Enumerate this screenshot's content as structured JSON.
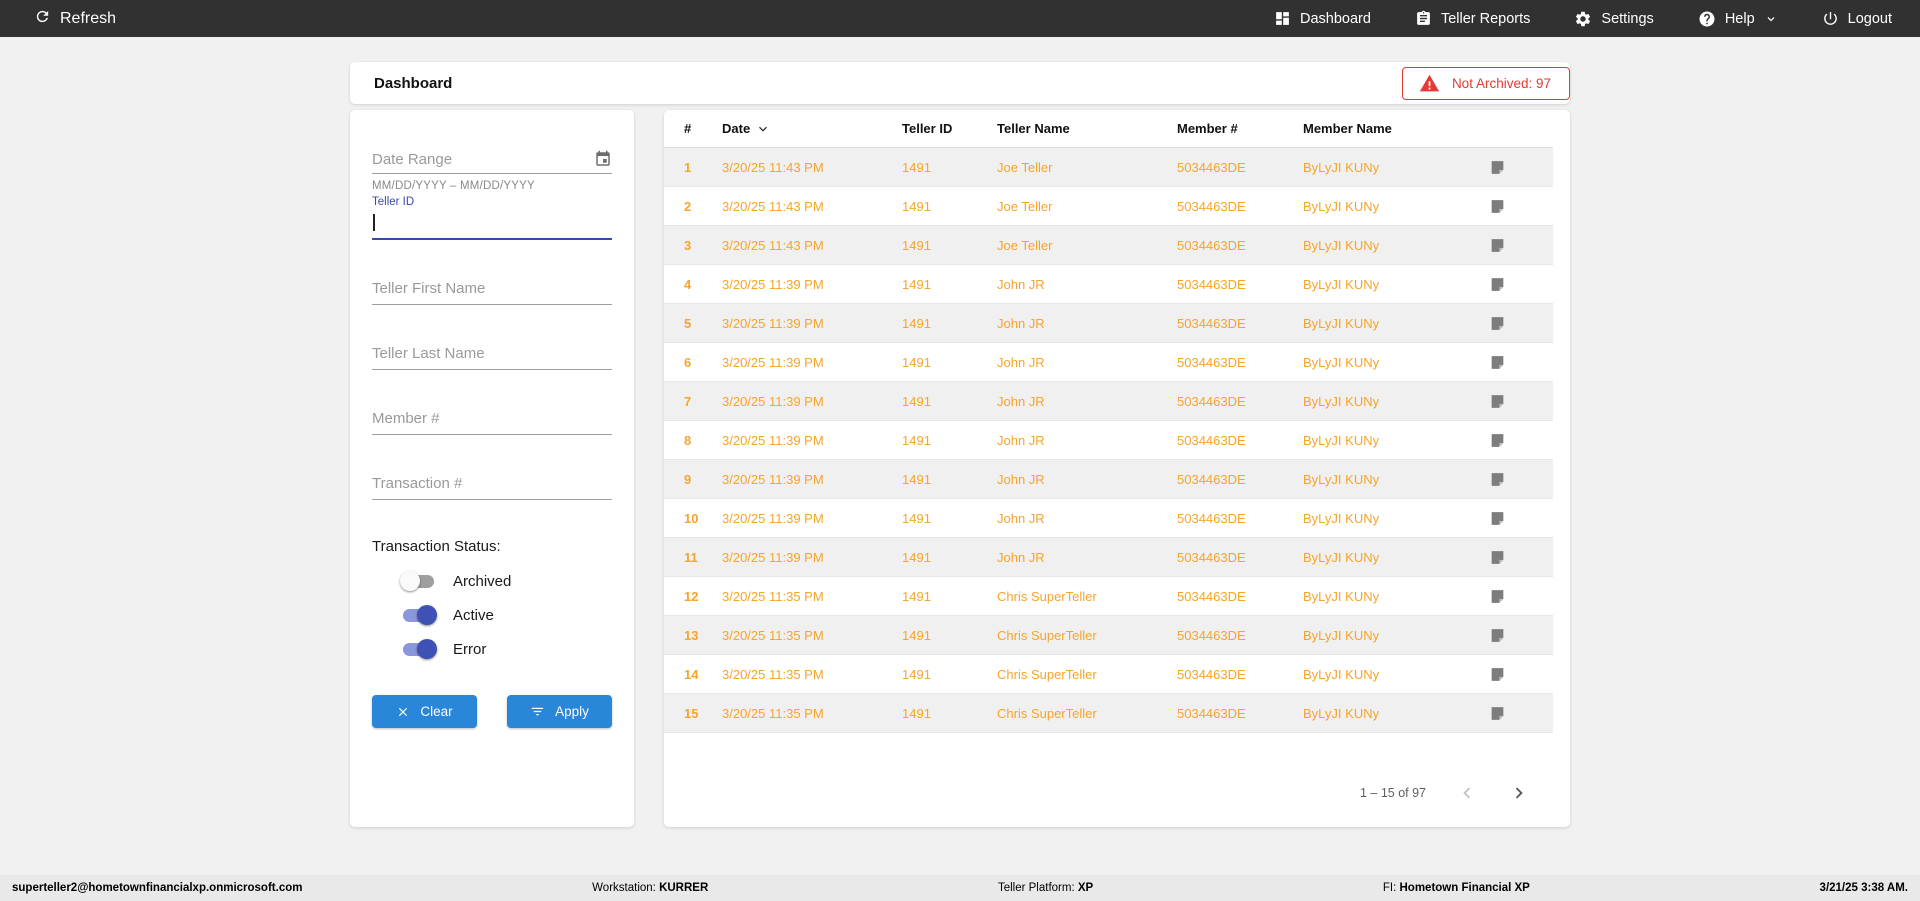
{
  "colors": {
    "topbar_bg": "#313131",
    "accent_orange": "#F7A428",
    "button_blue": "#2986D8",
    "toggle_on": "#3F51B5",
    "alert_red": "#E53935",
    "focus_indigo": "#3949AB"
  },
  "topnav": {
    "refresh_label": "Refresh",
    "items": [
      {
        "label": "Dashboard",
        "icon": "dashboard-icon"
      },
      {
        "label": "Teller Reports",
        "icon": "teller-reports-icon"
      },
      {
        "label": "Settings",
        "icon": "settings-icon"
      },
      {
        "label": "Help",
        "icon": "help-icon"
      },
      {
        "label": "Logout",
        "icon": "logout-icon"
      }
    ]
  },
  "header": {
    "title": "Dashboard",
    "alert": "Not Archived: 97"
  },
  "filters": {
    "date_range": {
      "label": "Date Range",
      "hint": "MM/DD/YYYY – MM/DD/YYYY"
    },
    "teller_id": {
      "label": "Teller ID",
      "value": ""
    },
    "teller_first_name": {
      "placeholder": "Teller First Name",
      "value": ""
    },
    "teller_last_name": {
      "placeholder": "Teller Last Name",
      "value": ""
    },
    "member_number": {
      "placeholder": "Member #",
      "value": ""
    },
    "transaction_number": {
      "placeholder": "Transaction #",
      "value": ""
    },
    "status": {
      "label": "Transaction Status:",
      "toggles": [
        {
          "label": "Archived",
          "on": false
        },
        {
          "label": "Active",
          "on": true
        },
        {
          "label": "Error",
          "on": true
        }
      ]
    },
    "clear_label": "Clear",
    "apply_label": "Apply"
  },
  "table": {
    "columns": [
      "#",
      "Date",
      "Teller ID",
      "Teller Name",
      "Member #",
      "Member Name"
    ],
    "sorted_column": "Date",
    "rows": [
      {
        "num": "1",
        "date": "3/20/25 11:43 PM",
        "teller_id": "1491",
        "teller_name": "Joe Teller",
        "member_num": "5034463DE",
        "member_name": "ByLyJI KUNy"
      },
      {
        "num": "2",
        "date": "3/20/25 11:43 PM",
        "teller_id": "1491",
        "teller_name": "Joe Teller",
        "member_num": "5034463DE",
        "member_name": "ByLyJI KUNy"
      },
      {
        "num": "3",
        "date": "3/20/25 11:43 PM",
        "teller_id": "1491",
        "teller_name": "Joe Teller",
        "member_num": "5034463DE",
        "member_name": "ByLyJI KUNy"
      },
      {
        "num": "4",
        "date": "3/20/25 11:39 PM",
        "teller_id": "1491",
        "teller_name": "John JR",
        "member_num": "5034463DE",
        "member_name": "ByLyJI KUNy"
      },
      {
        "num": "5",
        "date": "3/20/25 11:39 PM",
        "teller_id": "1491",
        "teller_name": "John JR",
        "member_num": "5034463DE",
        "member_name": "ByLyJI KUNy"
      },
      {
        "num": "6",
        "date": "3/20/25 11:39 PM",
        "teller_id": "1491",
        "teller_name": "John JR",
        "member_num": "5034463DE",
        "member_name": "ByLyJI KUNy"
      },
      {
        "num": "7",
        "date": "3/20/25 11:39 PM",
        "teller_id": "1491",
        "teller_name": "John JR",
        "member_num": "5034463DE",
        "member_name": "ByLyJI KUNy"
      },
      {
        "num": "8",
        "date": "3/20/25 11:39 PM",
        "teller_id": "1491",
        "teller_name": "John JR",
        "member_num": "5034463DE",
        "member_name": "ByLyJI KUNy"
      },
      {
        "num": "9",
        "date": "3/20/25 11:39 PM",
        "teller_id": "1491",
        "teller_name": "John JR",
        "member_num": "5034463DE",
        "member_name": "ByLyJI KUNy"
      },
      {
        "num": "10",
        "date": "3/20/25 11:39 PM",
        "teller_id": "1491",
        "teller_name": "John JR",
        "member_num": "5034463DE",
        "member_name": "ByLyJI KUNy"
      },
      {
        "num": "11",
        "date": "3/20/25 11:39 PM",
        "teller_id": "1491",
        "teller_name": "John JR",
        "member_num": "5034463DE",
        "member_name": "ByLyJI KUNy"
      },
      {
        "num": "12",
        "date": "3/20/25 11:35 PM",
        "teller_id": "1491",
        "teller_name": "Chris SuperTeller",
        "member_num": "5034463DE",
        "member_name": "ByLyJI KUNy"
      },
      {
        "num": "13",
        "date": "3/20/25 11:35 PM",
        "teller_id": "1491",
        "teller_name": "Chris SuperTeller",
        "member_num": "5034463DE",
        "member_name": "ByLyJI KUNy"
      },
      {
        "num": "14",
        "date": "3/20/25 11:35 PM",
        "teller_id": "1491",
        "teller_name": "Chris SuperTeller",
        "member_num": "5034463DE",
        "member_name": "ByLyJI KUNy"
      },
      {
        "num": "15",
        "date": "3/20/25 11:35 PM",
        "teller_id": "1491",
        "teller_name": "Chris SuperTeller",
        "member_num": "5034463DE",
        "member_name": "ByLyJI KUNy"
      }
    ],
    "pagination": {
      "label": "1 – 15 of 97"
    }
  },
  "footer": {
    "user": "superteller2@hometownfinancialxp.onmicrosoft.com",
    "workstation_label": "Workstation:",
    "workstation": "KURRER",
    "platform_label": "Teller Platform:",
    "platform": "XP",
    "fi_label": "FI:",
    "fi": "Hometown Financial XP",
    "datetime": "3/21/25 3:38 AM."
  }
}
